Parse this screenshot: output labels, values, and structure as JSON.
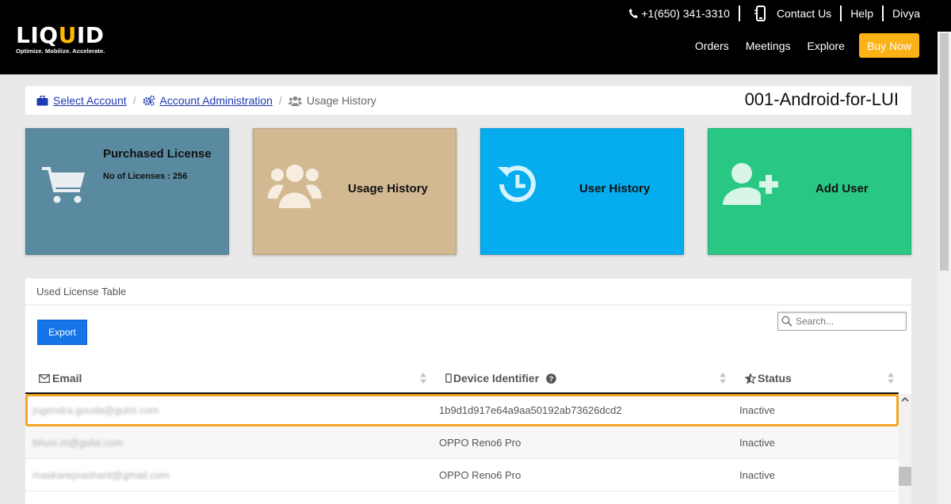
{
  "header": {
    "logo_text": "LIQUID",
    "logo_tagline": "Optimize. Mobilize. Accelerate.",
    "phone": "+1(650) 341-3310",
    "contact": "Contact Us",
    "help": "Help",
    "user": "Divya",
    "nav": [
      "Orders",
      "Meetings",
      "Explore"
    ],
    "buy_now": "Buy Now"
  },
  "breadcrumb": {
    "items": [
      "Select Account",
      "Account Administration",
      "Usage History"
    ],
    "account_name": "001-Android-for-LUI"
  },
  "tiles": [
    {
      "title": "Purchased License",
      "subtitle": "No of Licenses : 256",
      "color": "#5a8aa0",
      "icon": "shopping-cart-icon"
    },
    {
      "title": "Usage History",
      "color": "#d3b992",
      "icon": "users-icon"
    },
    {
      "title": "User History",
      "color": "#05adee",
      "icon": "history-icon"
    },
    {
      "title": "Add User",
      "color": "#28c784",
      "icon": "user-plus-icon"
    }
  ],
  "table": {
    "title": "Used License Table",
    "export_label": "Export",
    "search_placeholder": "Search...",
    "columns": [
      "Email",
      "Device Identifier",
      "Status"
    ],
    "rows": [
      {
        "email": "jogendra.gouda@gulst.com",
        "device": "1b9d1d917e64a9aa50192ab73626dcd2",
        "status": "Inactive"
      },
      {
        "email": "bhuvi.m@gulst.com",
        "device": "OPPO Reno6 Pro",
        "status": "Inactive"
      },
      {
        "email": "maskareprashant@gmail.com",
        "device": "OPPO Reno6 Pro",
        "status": "Inactive"
      }
    ]
  },
  "colors": {
    "accent": "#fbb216",
    "export": "#1474e8",
    "highlight": "#f4a622"
  }
}
